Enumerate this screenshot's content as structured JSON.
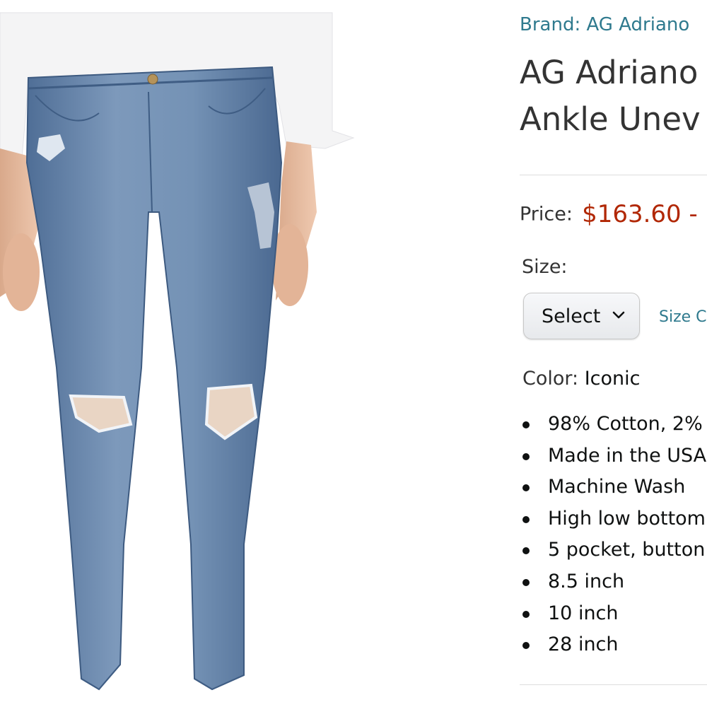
{
  "product": {
    "brand_link": "Brand: AG Adriano",
    "title_lines": [
      "AG Adriano",
      "Ankle Unev"
    ],
    "price_label": "Price:",
    "price_value": "$163.60 -",
    "size_label": "Size:",
    "size_select_value": "Select",
    "size_chart_link": "Size C",
    "color_label": "Color:",
    "color_value": "Iconic",
    "bullets": [
      "98% Cotton, 2%",
      "Made in the USA",
      "Machine Wash",
      "High low bottom",
      "5 pocket, button",
      "8.5 inch",
      "10 inch",
      "28 inch"
    ]
  },
  "icons": {
    "size_dropdown": "chevron-down-icon"
  },
  "colors": {
    "link": "#2f7a8e",
    "price": "#b12704",
    "heading": "#333333",
    "text": "#0f1111"
  }
}
